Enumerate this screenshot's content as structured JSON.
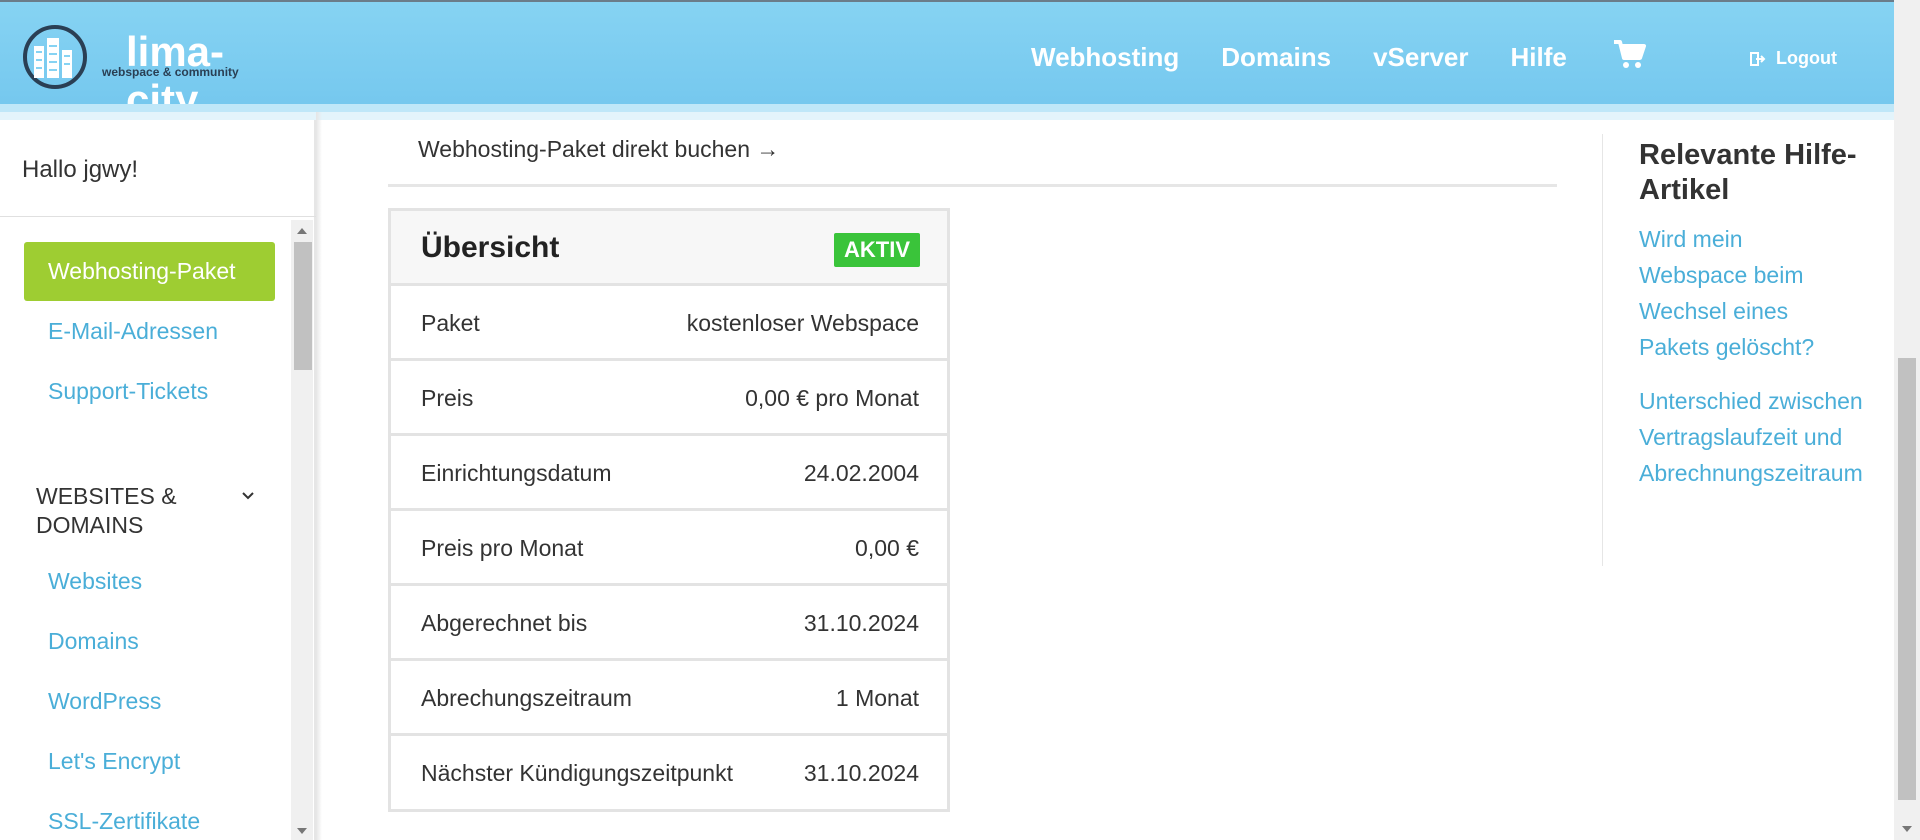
{
  "header": {
    "logo_text": "lima-city",
    "logo_subtitle": "webspace & community",
    "nav": [
      "Webhosting",
      "Domains",
      "vServer",
      "Hilfe"
    ],
    "cart_icon": "cart-icon",
    "logout_label": "Logout",
    "logout_icon": "logout-icon"
  },
  "sidebar": {
    "greeting": "Hallo jgwy!",
    "items_top": [
      "Webhosting-Paket",
      "E-Mail-Adressen",
      "Support-Tickets"
    ],
    "active_item": "Webhosting-Paket",
    "section_heading": "WEBSITES & DOMAINS",
    "section_items": [
      "Websites",
      "Domains",
      "WordPress",
      "Let's Encrypt",
      "SSL-Zertifikate"
    ]
  },
  "main": {
    "book_link": "Webhosting-Paket direkt buchen →",
    "card": {
      "title": "Übersicht",
      "status": "AKTIV",
      "rows": [
        {
          "label": "Paket",
          "value": "kostenloser Webspace"
        },
        {
          "label": "Preis",
          "value": "0,00 € pro Monat"
        },
        {
          "label": "Einrichtungsdatum",
          "value": "24.02.2004"
        },
        {
          "label": "Preis pro Monat",
          "value": "0,00 €"
        },
        {
          "label": "Abgerechnet bis",
          "value": "31.10.2024"
        },
        {
          "label": "Abrechungszeitraum",
          "value": "1 Monat"
        },
        {
          "label": "Nächster Kündigungszeitpunkt",
          "value": "31.10.2024"
        }
      ]
    }
  },
  "help": {
    "title": "Relevante Hilfe-Artikel",
    "links": [
      "Wird mein Webspace beim Wechsel eines Pakets gelöscht?",
      "Unterschied zwischen Vertragslaufzeit und Abrechnungszeitraum"
    ]
  },
  "colors": {
    "header_bg": "#7fcff2",
    "accent_link": "#4aaed8",
    "active_green": "#9ecd32",
    "badge_green": "#3ac43a"
  }
}
